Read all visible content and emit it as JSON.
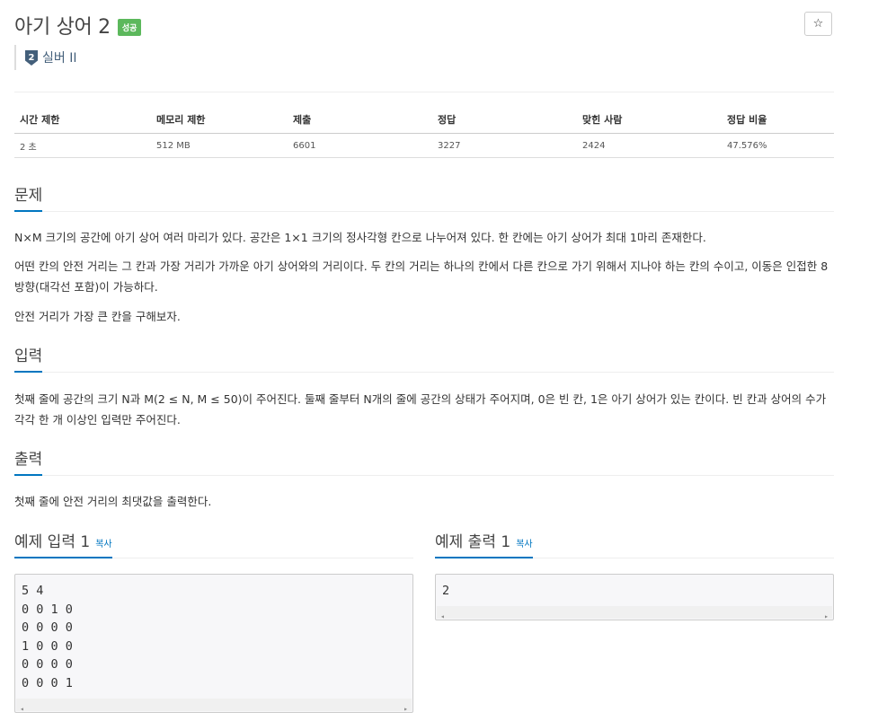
{
  "problem": {
    "title": "아기 상어 2",
    "status_badge": "성공",
    "star_icon": "☆",
    "tier_number": "2",
    "tier_label": "실버 II"
  },
  "info_table": {
    "headers": [
      "시간 제한",
      "메모리 제한",
      "제출",
      "정답",
      "맞힌 사람",
      "정답 비율"
    ],
    "values": [
      "2 초",
      "512 MB",
      "6601",
      "3227",
      "2424",
      "47.576%"
    ]
  },
  "sections": {
    "problem_heading": "문제",
    "problem_p1": "N×M 크기의 공간에 아기 상어 여러 마리가 있다. 공간은 1×1 크기의 정사각형 칸으로 나누어져 있다. 한 칸에는 아기 상어가 최대 1마리 존재한다.",
    "problem_p2": "어떤 칸의 안전 거리는 그 칸과 가장 거리가 가까운 아기 상어와의 거리이다. 두 칸의 거리는 하나의 칸에서 다른 칸으로 가기 위해서 지나야 하는 칸의 수이고, 이동은 인접한 8방향(대각선 포함)이 가능하다.",
    "problem_p3": "안전 거리가 가장 큰 칸을 구해보자.",
    "input_heading": "입력",
    "input_p1": "첫째 줄에 공간의 크기 N과 M(2 ≤ N, M ≤ 50)이 주어진다. 둘째 줄부터 N개의 줄에 공간의 상태가 주어지며, 0은 빈 칸, 1은 아기 상어가 있는 칸이다. 빈 칸과 상어의 수가 각각 한 개 이상인 입력만 주어진다.",
    "output_heading": "출력",
    "output_p1": "첫째 줄에 안전 거리의 최댓값을 출력한다."
  },
  "examples": {
    "input_heading": "예제 입력 1",
    "output_heading": "예제 출력 1",
    "copy_label": "복사",
    "input_text": "5 4\n0 0 1 0\n0 0 0 0\n1 0 0 0\n0 0 0 0\n0 0 0 1",
    "output_text": "2",
    "scroll_left": "◂",
    "scroll_right": "▸"
  },
  "colors": {
    "badge": "#5cb85c",
    "accent": "#0076c0",
    "tier": "#435f7a"
  }
}
